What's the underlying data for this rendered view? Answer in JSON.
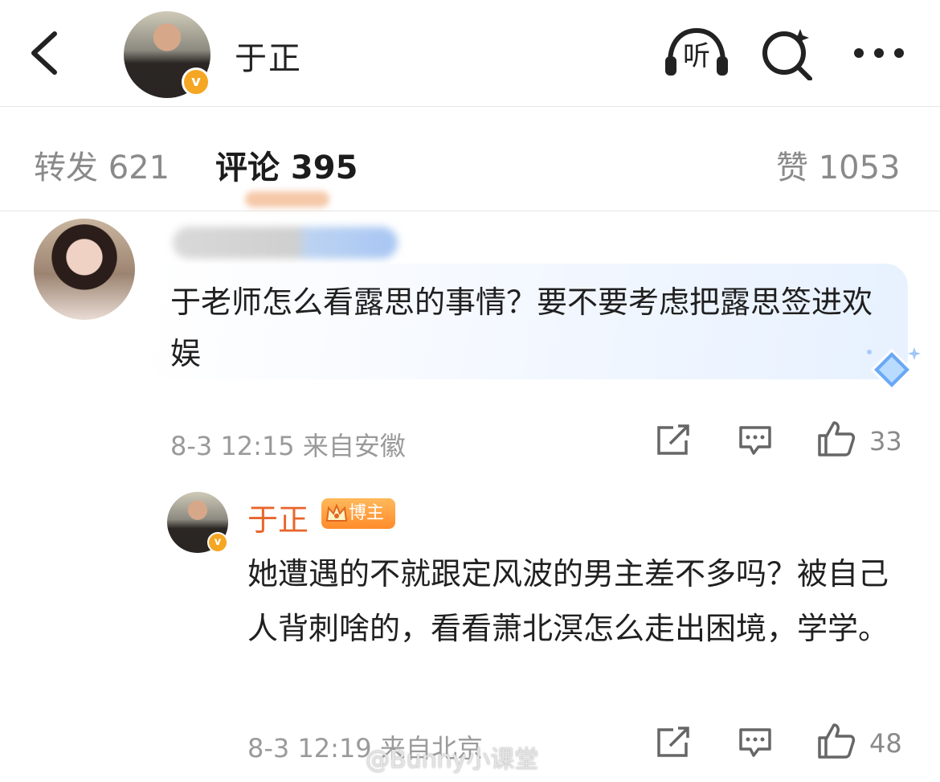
{
  "header": {
    "title": "于正",
    "listen_label": "听",
    "back_icon": "back-arrow-icon",
    "search_icon": "search-icon",
    "more_icon": "more-icon",
    "verified_label": "v"
  },
  "tabs": [
    {
      "label": "转发 621"
    },
    {
      "label": "评论 395"
    },
    {
      "label": "赞 1053"
    }
  ],
  "comment": {
    "text": "于老师怎么看露思的事情？要不要考虑把露思签进欢娱",
    "meta": "8-3 12:15  来自安徽",
    "likes": "33"
  },
  "reply": {
    "name": "于正",
    "badge": "博主",
    "text": "她遭遇的不就跟定风波的男主差不多吗？被自己人背刺啥的，看看萧北溟怎么走出困境，学学。",
    "meta": "8-3 12:19  来自北京",
    "likes": "48",
    "verified_label": "v"
  },
  "watermark": "@Bunny小课堂",
  "colors": {
    "accent_orange": "#e8652c",
    "badge_gold": "#f5a623",
    "text_gray": "#8a8a8a"
  }
}
